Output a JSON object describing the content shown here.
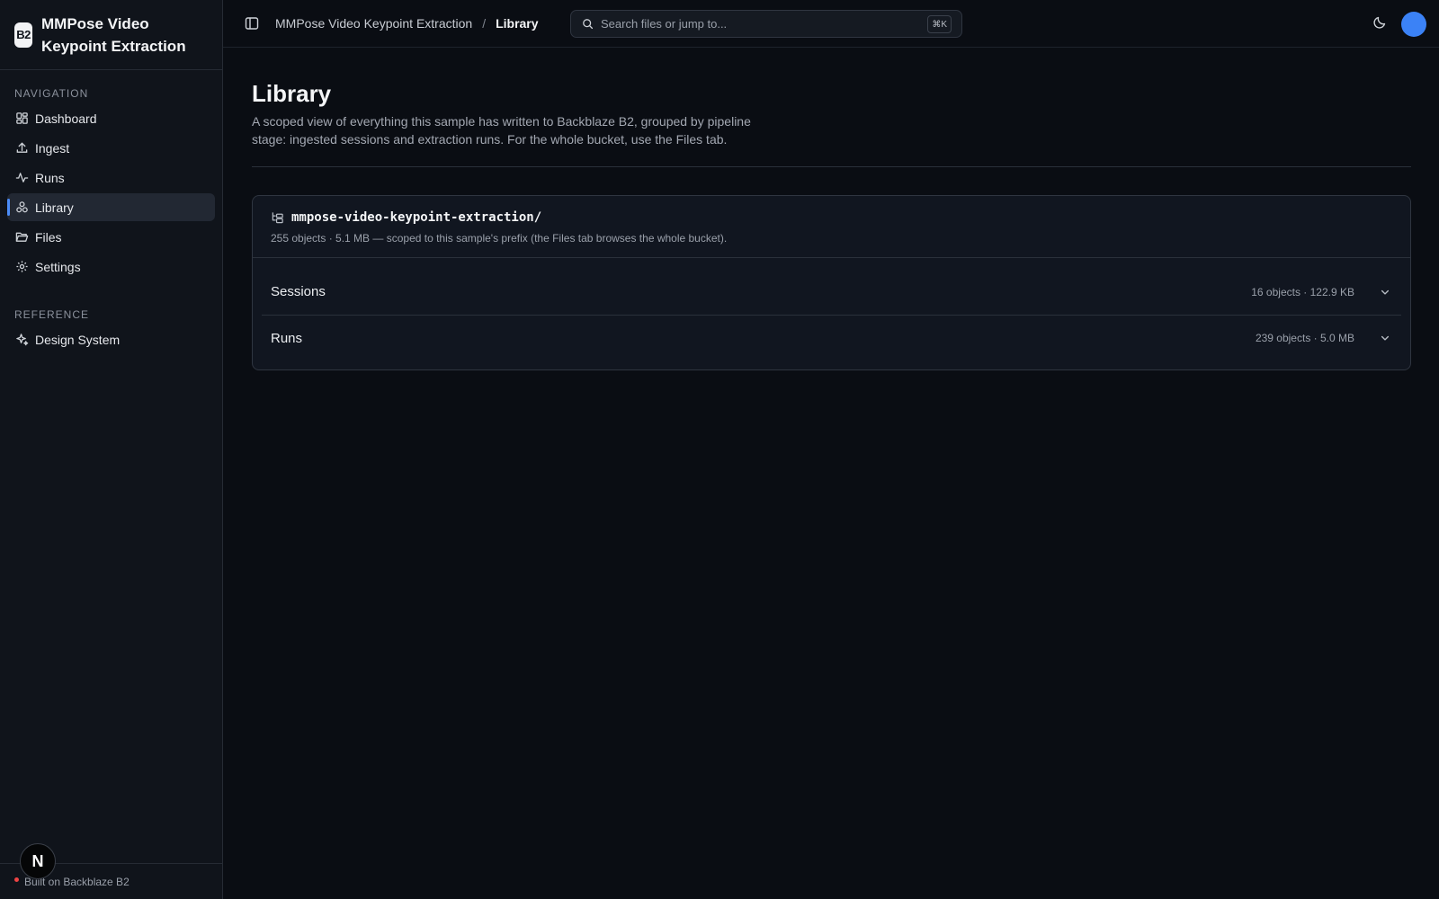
{
  "app": {
    "logo_text": "B2",
    "title": "MMPose Video Keypoint Extraction"
  },
  "sidebar": {
    "navigation_label": "NAVIGATION",
    "items": [
      {
        "label": "Dashboard",
        "icon": "dashboard-icon"
      },
      {
        "label": "Ingest",
        "icon": "upload-icon"
      },
      {
        "label": "Runs",
        "icon": "activity-icon"
      },
      {
        "label": "Library",
        "icon": "library-icon",
        "active": true
      },
      {
        "label": "Files",
        "icon": "folder-open-icon"
      },
      {
        "label": "Settings",
        "icon": "gear-icon"
      }
    ],
    "reference_label": "REFERENCE",
    "reference_items": [
      {
        "label": "Design System",
        "icon": "sparkles-icon"
      }
    ],
    "footer_text": "Built on Backblaze B2",
    "badge": "N"
  },
  "topbar": {
    "breadcrumb": [
      "MMPose Video Keypoint Extraction",
      "Library"
    ],
    "breadcrumb_separator": "/",
    "search": {
      "placeholder": "Search files or jump to...",
      "shortcut": "⌘K"
    }
  },
  "page": {
    "title": "Library",
    "description": "A scoped view of everything this sample has written to Backblaze B2, grouped by pipeline stage: ingested sessions and extraction runs. For the whole bucket, use the Files tab."
  },
  "card": {
    "prefix": "mmpose-video-keypoint-extraction/",
    "meta": "255 objects · 5.1 MB — scoped to this sample's prefix (the Files tab browses the whole bucket).",
    "groups": [
      {
        "label": "Sessions",
        "stats": "16 objects · 122.9 KB"
      },
      {
        "label": "Runs",
        "stats": "239 objects · 5.0 MB"
      }
    ]
  },
  "colors": {
    "accent": "#4b8cf7",
    "avatar": "#3b82f6",
    "status": "#ef4444",
    "background": "#0a0d13"
  }
}
